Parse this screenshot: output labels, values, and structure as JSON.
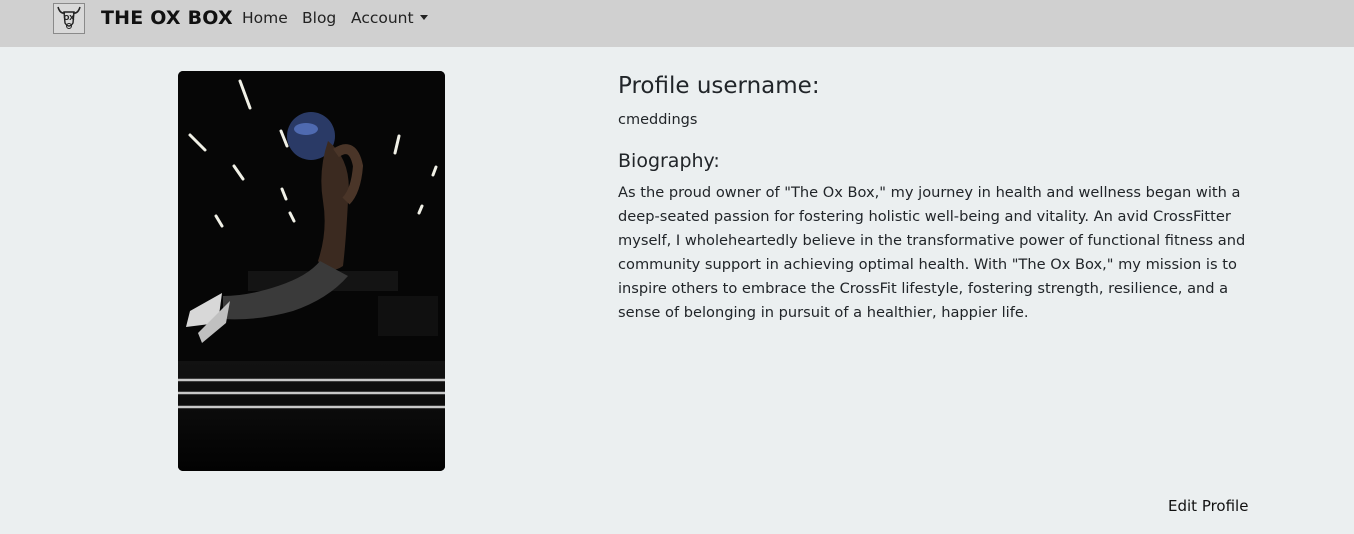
{
  "navbar": {
    "brand_name": "THE OX BOX",
    "logo_icon": "ox-logo-icon",
    "links": {
      "home": "Home",
      "blog": "Blog",
      "account": "Account"
    }
  },
  "profile": {
    "image_icon": "athlete-photo",
    "username_heading": "Profile username:",
    "username": "cmeddings",
    "biography_heading": "Biography:",
    "biography": "As the proud owner of \"The Ox Box,\" my journey in health and wellness began with a deep-seated passion for fostering holistic well-being and vitality. An avid CrossFitter myself, I wholeheartedly believe in the transformative power of functional fitness and community support in achieving optimal health. With \"The Ox Box,\" my mission is to inspire others to embrace the CrossFit lifestyle, fostering strength, resilience, and a sense of belonging in pursuit of a healthier, happier life."
  },
  "actions": {
    "edit_profile": "Edit Profile"
  },
  "colors": {
    "navbar_bg": "#d0d0d0",
    "page_bg": "#ebeff0",
    "text": "#212529"
  }
}
